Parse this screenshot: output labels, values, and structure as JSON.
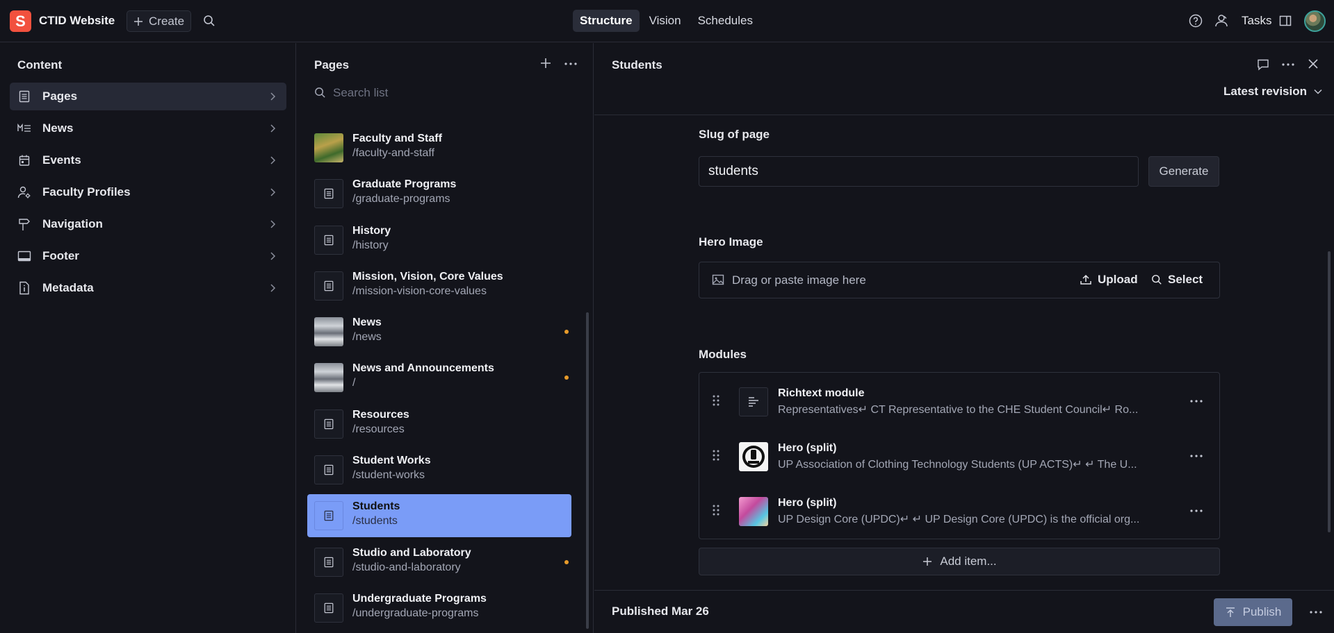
{
  "app": {
    "logo_letter": "S",
    "title": "CTID Website",
    "create_label": "Create"
  },
  "top_tabs": [
    "Structure",
    "Vision",
    "Schedules"
  ],
  "top_right": {
    "tasks_label": "Tasks"
  },
  "content": {
    "header": "Content",
    "items": [
      {
        "label": "Pages",
        "icon": "document-icon",
        "active": true
      },
      {
        "label": "News",
        "icon": "markdown-icon"
      },
      {
        "label": "Events",
        "icon": "calendar-icon"
      },
      {
        "label": "Faculty Profiles",
        "icon": "user-gear-icon"
      },
      {
        "label": "Navigation",
        "icon": "signpost-icon"
      },
      {
        "label": "Footer",
        "icon": "footer-icon"
      },
      {
        "label": "Metadata",
        "icon": "info-doc-icon"
      }
    ]
  },
  "pages": {
    "header": "Pages",
    "search_placeholder": "Search list",
    "items": [
      {
        "title": "Faculty and Staff",
        "slug": "/faculty-and-staff",
        "thumb": "photo",
        "dot": false
      },
      {
        "title": "Graduate Programs",
        "slug": "/graduate-programs",
        "thumb": "doc",
        "dot": false
      },
      {
        "title": "History",
        "slug": "/history",
        "thumb": "doc",
        "dot": false
      },
      {
        "title": "Mission, Vision, Core Values",
        "slug": "/mission-vision-core-values",
        "thumb": "doc",
        "dot": false
      },
      {
        "title": "News",
        "slug": "/news",
        "thumb": "photo",
        "dot": true
      },
      {
        "title": "News and Announcements",
        "slug": "/",
        "thumb": "photo",
        "dot": true
      },
      {
        "title": "Resources",
        "slug": "/resources",
        "thumb": "doc",
        "dot": false
      },
      {
        "title": "Student Works",
        "slug": "/student-works",
        "thumb": "doc",
        "dot": false
      },
      {
        "title": "Students",
        "slug": "/students",
        "thumb": "doc",
        "dot": false,
        "active": true
      },
      {
        "title": "Studio and Laboratory",
        "slug": "/studio-and-laboratory",
        "thumb": "doc",
        "dot": true
      },
      {
        "title": "Undergraduate Programs",
        "slug": "/undergraduate-programs",
        "thumb": "doc",
        "dot": false
      }
    ]
  },
  "document": {
    "title": "Students",
    "revision": "Latest revision",
    "slug_label": "Slug of page",
    "slug_value": "students",
    "generate_label": "Generate",
    "hero_label": "Hero Image",
    "hero_placeholder": "Drag or paste image here",
    "upload_label": "Upload",
    "select_label": "Select",
    "modules_label": "Modules",
    "modules": [
      {
        "title": "Richtext module",
        "desc": "Representatives↵ CT Representative to the CHE Student Council↵ Ro...",
        "thumb": "richtext"
      },
      {
        "title": "Hero (split)",
        "desc": "UP Association of Clothing Technology Students (UP ACTS)↵ ↵ The U...",
        "thumb": "acts"
      },
      {
        "title": "Hero (split)",
        "desc": "UP Design Core (UPDC)↵ ↵ UP Design Core (UPDC) is the official org...",
        "thumb": "updc"
      }
    ],
    "add_item_label": "Add item...",
    "published_label": "Published Mar 26",
    "publish_label": "Publish"
  },
  "colors": {
    "accent": "#7a9cf7",
    "logo": "#f2513e",
    "draft_dot": "#e79b2a",
    "background": "#13141b"
  }
}
